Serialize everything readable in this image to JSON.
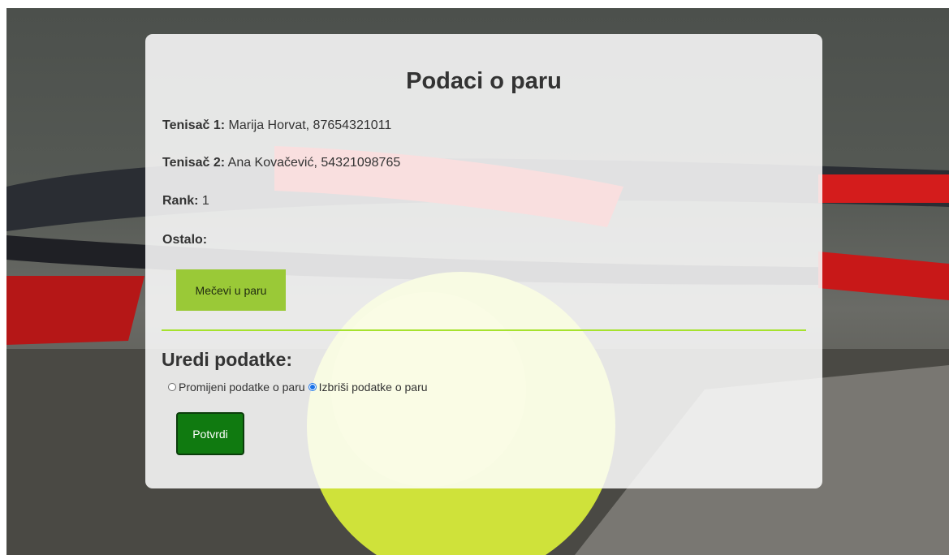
{
  "page": {
    "title": "Podaci o paru"
  },
  "pair": {
    "player1_label": "Tenisač 1:",
    "player1_value": "Marija Horvat, 87654321011",
    "player2_label": "Tenisač 2:",
    "player2_value": "Ana Kovačević, 54321098765",
    "rank_label": "Rank:",
    "rank_value": "1",
    "other_label": "Ostalo:",
    "other_value": ""
  },
  "actions": {
    "matches_button": "Mečevi u paru"
  },
  "edit": {
    "title": "Uredi podatke:",
    "options": [
      {
        "label": "Promijeni podatke o paru",
        "checked": false
      },
      {
        "label": "Izbriši podatke o paru",
        "checked": true
      }
    ],
    "confirm_button": "Potvrdi"
  },
  "colors": {
    "matches_button_bg": "#9ac937",
    "confirm_button_bg": "#107a10",
    "divider": "#a6e22e",
    "radio_accent": "#1a73e8"
  }
}
